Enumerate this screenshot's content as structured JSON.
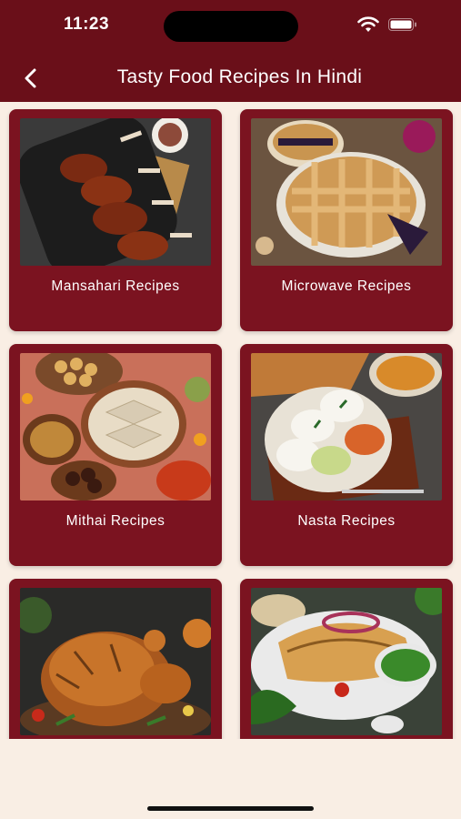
{
  "status_bar": {
    "time": "11:23"
  },
  "header": {
    "title": "Tasty Food Recipes In Hindi",
    "back_icon": "chevron-left-icon"
  },
  "categories": [
    {
      "label": "Mansahari Recipes"
    },
    {
      "label": "Microwave Recipes"
    },
    {
      "label": "Mithai Recipes"
    },
    {
      "label": "Nasta Recipes"
    },
    {
      "label": ""
    },
    {
      "label": ""
    }
  ],
  "colors": {
    "header": "#6a0f19",
    "card": "#7b1320",
    "background": "#f9eee4",
    "text": "#ffffff"
  }
}
